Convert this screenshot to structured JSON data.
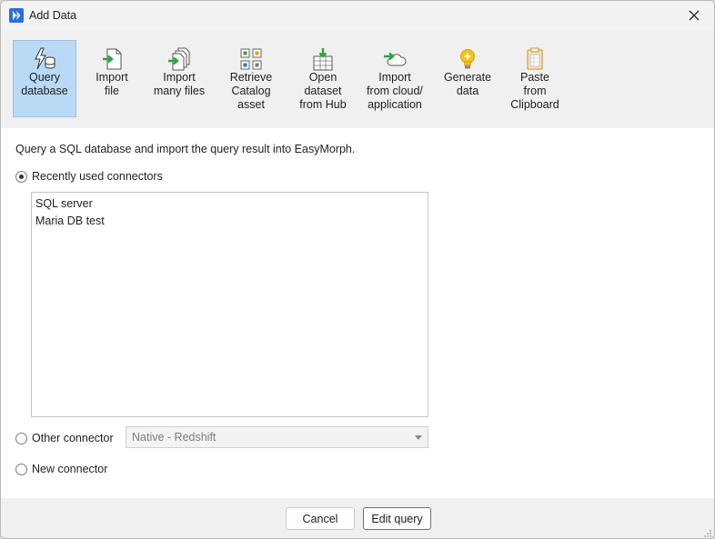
{
  "window": {
    "title": "Add Data"
  },
  "toolbar": {
    "items": [
      {
        "label": "Query\ndatabase",
        "icon": "query-database-icon"
      },
      {
        "label": "Import\nfile",
        "icon": "import-file-icon"
      },
      {
        "label": "Import\nmany files",
        "icon": "import-many-files-icon"
      },
      {
        "label": "Retrieve\nCatalog\nasset",
        "icon": "catalog-asset-icon"
      },
      {
        "label": "Open\ndataset\nfrom Hub",
        "icon": "hub-dataset-icon"
      },
      {
        "label": "Import\nfrom cloud/\napplication",
        "icon": "cloud-import-icon"
      },
      {
        "label": "Generate\ndata",
        "icon": "lightbulb-icon"
      },
      {
        "label": "Paste\nfrom\nClipboard",
        "icon": "clipboard-icon"
      }
    ]
  },
  "content": {
    "description": "Query a SQL database and import the query result into EasyMorph.",
    "recent_label": "Recently used connectors",
    "recent_items": [
      "SQL server",
      "Maria DB test"
    ],
    "other_label": "Other connector",
    "other_selected": "Native - Redshift",
    "new_label": "New connector"
  },
  "footer": {
    "cancel": "Cancel",
    "edit": "Edit query"
  },
  "colors": {
    "accent": "#b8daf5",
    "brand": "#2b6fd6",
    "green": "#2aa63a"
  }
}
